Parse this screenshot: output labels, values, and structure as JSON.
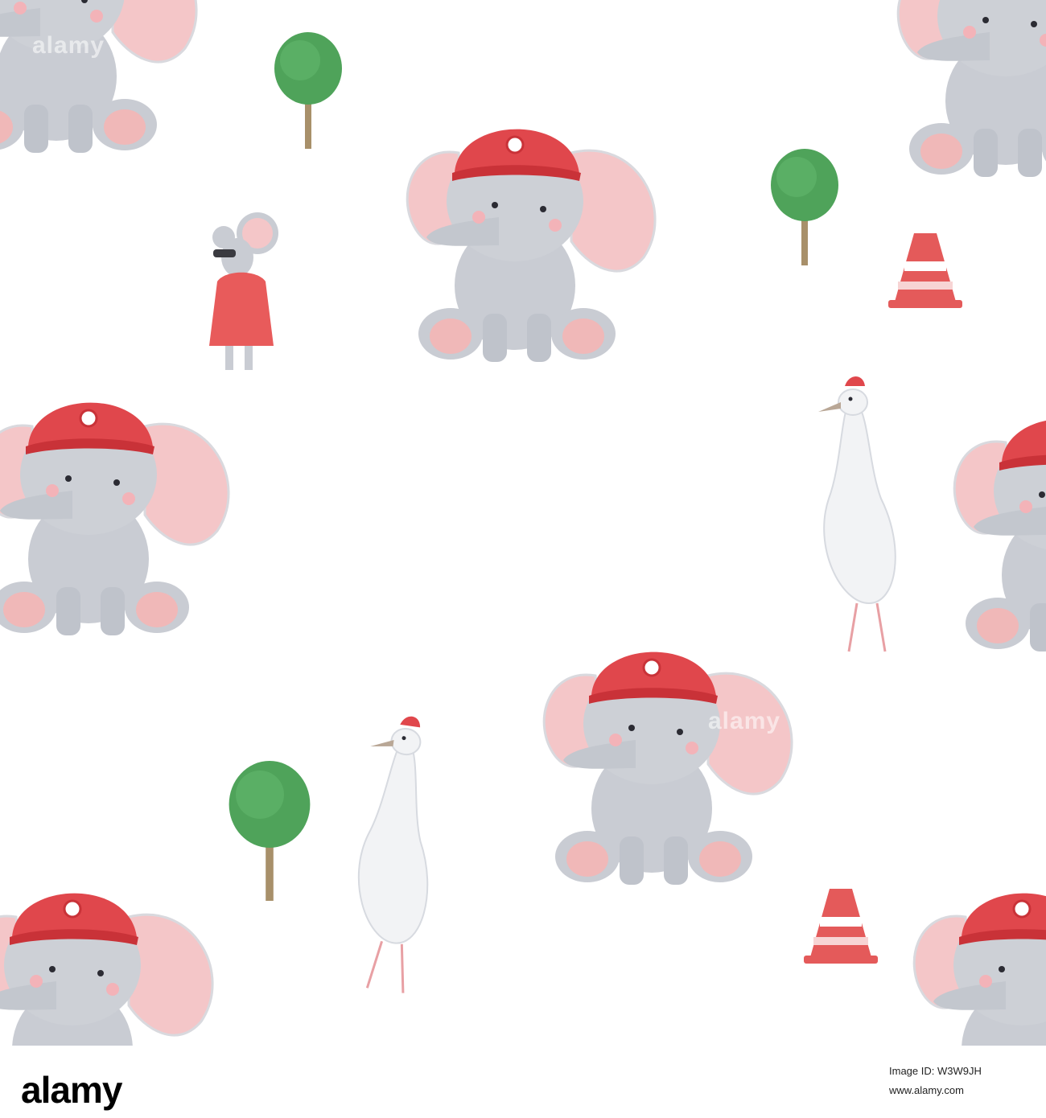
{
  "watermark": {
    "text": "alamy"
  },
  "footer": {
    "logo": "alamy",
    "image_id": "Image ID: W3W9JH",
    "url": "www.alamy.com"
  },
  "palette": {
    "elephant_body": "#c9ccd3",
    "elephant_ear": "#f4c6c8",
    "helmet": "#e0474c",
    "tree": "#4fa35a",
    "goose": "#f2f3f5",
    "cone": "#e45a5a"
  }
}
